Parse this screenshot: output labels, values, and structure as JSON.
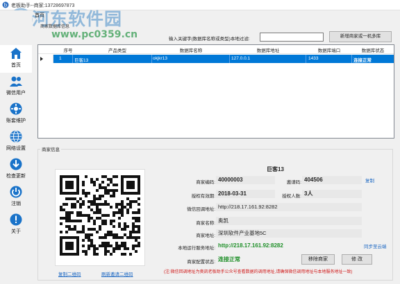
{
  "window": {
    "title": "老板助手--商家:13728697873"
  },
  "watermark": {
    "line1": "河东软件园",
    "line2": "www.pc0359.cn"
  },
  "sidebar": {
    "items": [
      {
        "label": "首页",
        "icon": "home-icon",
        "active": true
      },
      {
        "label": "微信用户",
        "icon": "users-icon"
      },
      {
        "label": "账套维护",
        "icon": "gear-icon"
      },
      {
        "label": "网络设置",
        "icon": "globe-icon"
      },
      {
        "label": "检查更新",
        "icon": "download-icon"
      },
      {
        "label": "注销",
        "icon": "power-icon"
      },
      {
        "label": "关于",
        "icon": "info-icon"
      }
    ]
  },
  "main": {
    "tab": "首页",
    "db_group_label": "商家数据库信息",
    "filter_label": "输入关键字(数据库名称或类型)本地过滤:",
    "filter_value": "",
    "new_button": "新增商家或一机多库"
  },
  "grid": {
    "columns": [
      "序号",
      "产品类型",
      "数据库名称",
      "数据库地址",
      "数据库端口",
      "数据库状态"
    ],
    "rows": [
      [
        "1",
        "巨客13",
        "okjkr13",
        "127.0.0.1",
        "1433",
        "连接正常"
      ]
    ]
  },
  "merchant": {
    "group_label": "商家信息",
    "name": "巨客13",
    "code_label": "商家编码:",
    "code": "40000003",
    "invite_label": "邀请码:",
    "invite": "404506",
    "copy_link": "复制",
    "expiry_label": "授权有效期:",
    "expiry": "2018-03-31",
    "users_label": "授权人数:",
    "users": "3人",
    "callback_label": "微信回调地址:",
    "callback": "http://218.17.161.92:8282",
    "mname_label": "商家名称:",
    "mname": "奥凯",
    "addr_label": "商家地址:",
    "addr": "深圳软件产业基地5C",
    "local_label": "本地运行服务地址:",
    "local": "http://218.17.161.92:8282",
    "sync_link": "同步至云端",
    "status_label": "商家配置状态:",
    "status": "连接正常",
    "remove_button": "移除商家",
    "edit_button": "修  改",
    "qr_copy": "复制二维码",
    "qr_refresh": "刷新邀请二维码",
    "note": "(注:微信回调地址为奥凯老板助手公众号查看数据的调用地址,请确保微信调用地址与本地服务地址一致)"
  },
  "colors": {
    "selected_row": "#0078d7",
    "link": "#1a66c2",
    "ok_green": "#1e8f28",
    "note_red": "#d01818"
  }
}
